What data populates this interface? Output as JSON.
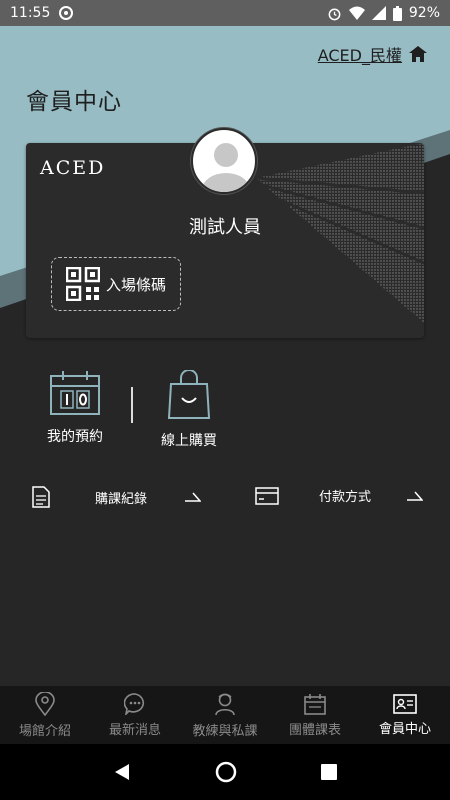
{
  "status_bar": {
    "time": "11:55",
    "battery": "92%"
  },
  "header": {
    "brand_link": "ACED_民權",
    "title": "會員中心"
  },
  "card": {
    "logo": "ACED",
    "member_name": "測試人員",
    "qr_label": "入場條碼"
  },
  "quick_actions": [
    {
      "label": "我的預約",
      "icon": "calendar-icon"
    },
    {
      "label": "線上購買",
      "icon": "shopping-bag-icon"
    }
  ],
  "links": [
    {
      "label": "購課紀錄",
      "icon": "document-icon"
    },
    {
      "label": "付款方式",
      "icon": "card-icon"
    }
  ],
  "bottom_nav": [
    {
      "label": "場館介紹",
      "icon": "location-pin-icon",
      "active": false
    },
    {
      "label": "最新消息",
      "icon": "chat-bubble-icon",
      "active": false
    },
    {
      "label": "教練與私課",
      "icon": "coach-icon",
      "active": false
    },
    {
      "label": "團體課表",
      "icon": "calendar-icon",
      "active": false
    },
    {
      "label": "會員中心",
      "icon": "member-id-icon",
      "active": true
    }
  ],
  "colors": {
    "teal": "#97bcc4",
    "dark": "#262626",
    "card": "#2b2b2b"
  }
}
